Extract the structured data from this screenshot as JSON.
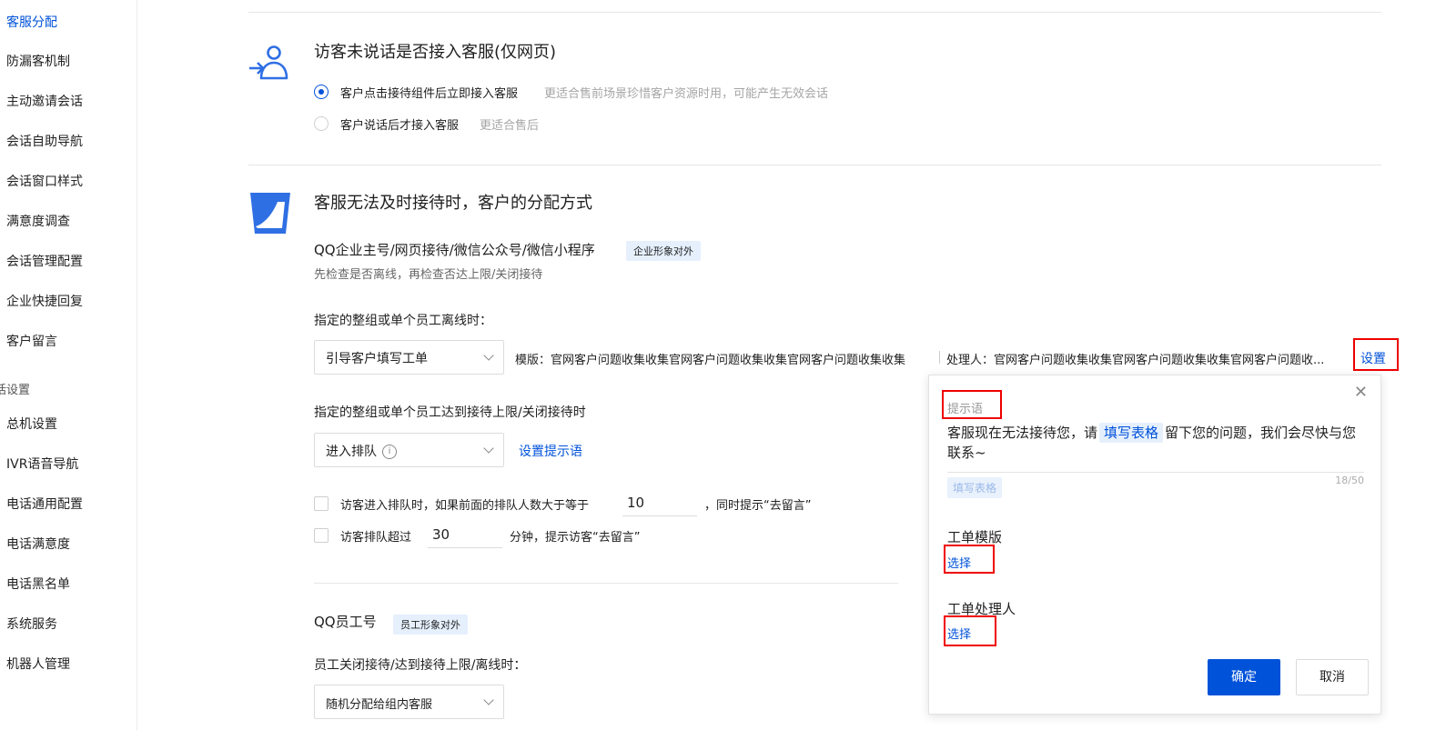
{
  "sidebar": {
    "items": [
      {
        "label": "客服分配",
        "active": true
      },
      {
        "label": "防漏客机制"
      },
      {
        "label": "主动邀请会话"
      },
      {
        "label": "会话自助导航"
      },
      {
        "label": "会话窗口样式"
      },
      {
        "label": "满意度调查"
      },
      {
        "label": "会话管理配置"
      },
      {
        "label": "企业快捷回复"
      },
      {
        "label": "客户留言"
      }
    ],
    "group_label": "话设置",
    "phone_items": [
      {
        "label": "总机设置"
      },
      {
        "label": "IVR语音导航"
      },
      {
        "label": "电话通用配置"
      },
      {
        "label": "电话满意度"
      },
      {
        "label": "电话黑名单"
      },
      {
        "label": "系统服务"
      },
      {
        "label": "机器人管理"
      }
    ]
  },
  "visitor_section": {
    "title": "访客未说话是否接入客服(仅网页)",
    "options": [
      {
        "label": "客户点击接待组件后立即接入客服",
        "hint": "更适合售前场景珍惜客户资源时用，可能产生无效会话",
        "selected": true
      },
      {
        "label": "客户说话后才接入客服",
        "hint": "更适合售后",
        "selected": false
      }
    ]
  },
  "assign_section": {
    "title": "客服无法及时接待时，客户的分配方式",
    "channels_title": "QQ企业主号/网页接待/微信公众号/微信小程序",
    "channels_badge": "企业形象对外",
    "channels_desc": "先检查是否离线，再检查否达上限/关闭接待",
    "offline_label": "指定的整组或单个员工离线时：",
    "offline_select": "引导客户填写工单",
    "offline_template": "模版：官网客户问题收集收集官网客户问题收集收集官网客户问题收集收集",
    "offline_handler": "处理人：官网客户问题收集收集官网客户问题收集收集官网客户问题收...",
    "offline_setting_link": "设置",
    "limit_label": "指定的整组或单个员工达到接待上限/关闭接待时",
    "limit_select": "进入排队",
    "limit_info_icon": "info-icon",
    "limit_link": "设置提示语",
    "queue_check_prefix": "访客进入排队时，如果前面的排队人数大于等于",
    "queue_check_value": "10",
    "queue_check_suffix": "，同时提示“去留言”",
    "wait_check_prefix": "访客排队超过",
    "wait_check_value": "30",
    "wait_check_suffix": "分钟，提示访客“去留言”",
    "staff_title": "QQ员工号",
    "staff_badge": "员工形象对外",
    "staff_label": "员工关闭接待/达到接待上限/离线时：",
    "staff_select": "随机分配给组内客服"
  },
  "popup": {
    "prompt_label": "提示语",
    "prompt_text_before": "客服现在无法接待您，请",
    "prompt_tag": "填写表格",
    "prompt_text_after": "留下您的问题，我们会尽快与您联系~",
    "insert_chip": "填写表格",
    "counter": "18/50",
    "template_title": "工单模版",
    "template_link": "选择",
    "handler_title": "工单处理人",
    "handler_link": "选择",
    "ok_label": "确定",
    "cancel_label": "取消"
  },
  "colors": {
    "brand": "#0052d9",
    "highlight_box": "#e00000",
    "badge_bg": "#e6f0fd"
  }
}
